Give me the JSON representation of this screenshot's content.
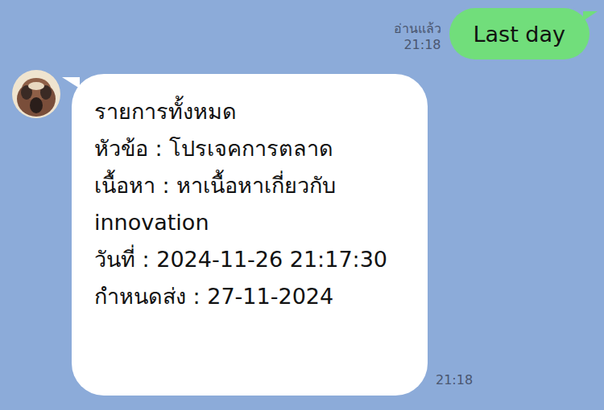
{
  "outgoing": {
    "text": "Last day",
    "read_label": "อ่านแล้ว",
    "time": "21:18"
  },
  "incoming": {
    "lines": [
      "รายการทั้งหมด",
      "หัวข้อ : โปรเจคการตลาด",
      "เนื้อหา : หาเนื้อหาเกี่ยวกับ",
      "innovation",
      "วันที่ : 2024-11-26 21:17:30",
      "กำหนดส่ง : 27-11-2024"
    ],
    "time": "21:18"
  }
}
